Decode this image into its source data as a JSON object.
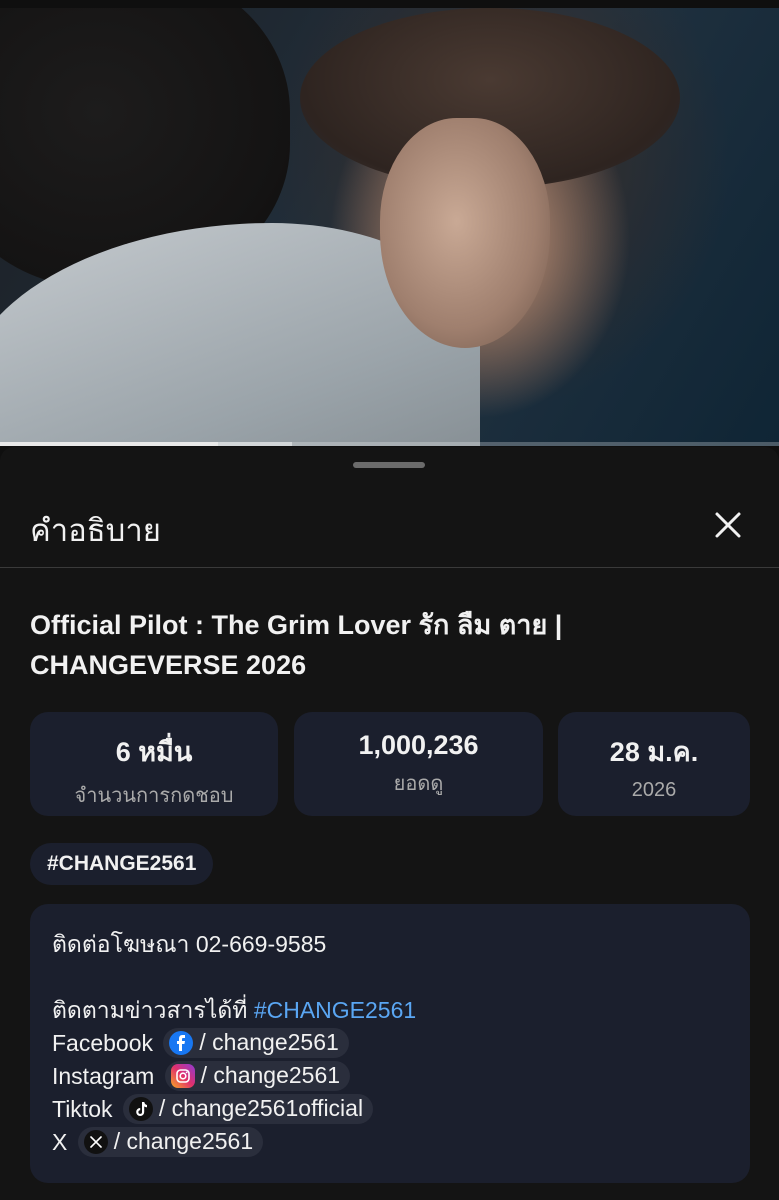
{
  "player": {
    "progress_played": 0.28,
    "progress_buffered": 0.375
  },
  "sheet": {
    "title": "คำอธิบาย"
  },
  "video": {
    "title": "Official Pilot : The Grim Lover รัก ลืม ตาย | CHANGEVERSE 2026"
  },
  "stats": [
    {
      "value": "6 หมื่น",
      "label": "จำนวนการกดชอบ"
    },
    {
      "value": "1,000,236",
      "label": "ยอดดู"
    },
    {
      "value": "28 ม.ค.",
      "label": "2026"
    }
  ],
  "hashtag_chip": "#CHANGE2561",
  "description": {
    "contact": "ติดต่อโฆษณา 02-669-9585",
    "follow_prefix": "ติดตามข่าวสารได้ที่ ",
    "follow_hashtag": "#CHANGE2561",
    "socials": [
      {
        "platform": "Facebook",
        "handle": "/ change2561",
        "icon": "facebook-icon",
        "color": "#1877f2"
      },
      {
        "platform": "Instagram",
        "handle": "/ change2561",
        "icon": "instagram-icon",
        "color": "#e1306c"
      },
      {
        "platform": "Tiktok",
        "handle": "/ change2561official",
        "icon": "tiktok-icon",
        "color": "#111111"
      },
      {
        "platform": "X",
        "handle": "/ change2561",
        "icon": "x-icon",
        "color": "#111111"
      }
    ]
  },
  "colors": {
    "background": "#0f0f0f",
    "sheet": "#141414",
    "card": "#1b1f2d",
    "link": "#5aa6f3"
  }
}
